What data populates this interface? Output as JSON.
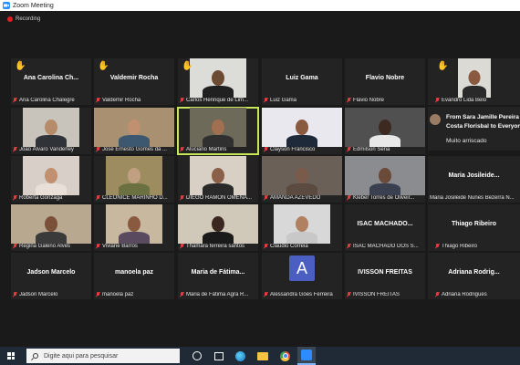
{
  "window": {
    "title": "Zoom Meeting"
  },
  "recording": {
    "label": "Recording"
  },
  "tiles": [
    {
      "big": "Ana Carolina Ch...",
      "name": "Ana Carolina Chalegre",
      "hand": true
    },
    {
      "big": "Valdemir Rocha",
      "name": "Valdemir Rocha",
      "hand": true
    },
    {
      "big": "",
      "name": "Carlos Henrique de Lim...",
      "hand": true
    },
    {
      "big": "Luiz Gama",
      "name": "Luiz Gama",
      "hand": false
    },
    {
      "big": "Flavio Nobre",
      "name": "Flavio Nobre",
      "hand": false
    },
    {
      "big": "",
      "name": "João Álvaro Vanderley",
      "hand": false
    },
    {
      "big": "",
      "name": "Jose Ernesto Gomes da ...",
      "hand": false
    },
    {
      "big": "",
      "name": "Aluciano Martins",
      "hand": false
    },
    {
      "big": "",
      "name": "Clayson Francisco",
      "hand": false
    },
    {
      "big": "",
      "name": "Edmilson Sena",
      "hand": false
    },
    {
      "big": "",
      "name": "Roberta Gonzaga",
      "hand": false
    },
    {
      "big": "",
      "name": "CLEONICE MARINHO D...",
      "hand": false
    },
    {
      "big": "",
      "name": "DIEGO RAMON OMENA...",
      "hand": false
    },
    {
      "big": "",
      "name": "AMANDA AZEVEDO",
      "hand": false
    },
    {
      "big": "",
      "name": "Kleber Torres de Oliveir...",
      "hand": false
    },
    {
      "big": "",
      "name": "Regina Galeno Alves",
      "hand": false
    },
    {
      "big": "",
      "name": "Viviane Barros",
      "hand": false
    },
    {
      "big": "",
      "name": "Thamara ferreira santos",
      "hand": false
    },
    {
      "big": "",
      "name": "Claudio Correia",
      "hand": false
    },
    {
      "big": "ISAC  MACHADO...",
      "name": "ISAC MACHADO DOS S...",
      "hand": false
    },
    {
      "big": "Jadson Marcelo",
      "name": "Jadson Marcelo",
      "hand": false
    },
    {
      "big": "manoela paz",
      "name": "manoela paz",
      "hand": false
    },
    {
      "big": "Maria  de  Fátima...",
      "name": "Maria de Fátima Agra R...",
      "hand": false
    },
    {
      "big": "",
      "name": "Alessandra Góes Ferreira",
      "hand": false,
      "avatar": "A"
    },
    {
      "big": "IVISSON FREITAS",
      "name": "IVISSON FREITAS",
      "hand": false
    }
  ],
  "right": [
    {
      "big": "",
      "name": "Evandro Lida Belo",
      "hand": true
    },
    {
      "big": "Maria  Josileide...",
      "name": "Maria Josileide Nunes Bezerra N...",
      "hand": false
    },
    {
      "big": "Thiago Ribeiro",
      "name": "Thiago Ribeiro",
      "hand": false
    },
    {
      "big": "Adriana  Rodrig...",
      "name": "Adriana Rodrigues",
      "hand": false
    }
  ],
  "chat": {
    "from_line1": "From Sara Jamille Pereira",
    "from_line2": "Costa Florisbal to Everyone",
    "message": "Muito arriscado"
  },
  "taskbar": {
    "search_placeholder": "Digite aqui para pesquisar"
  },
  "colors": {
    "tile": "#232323",
    "active": "#c8e65a",
    "mic_muted": "#e34040",
    "zoom": "#2d8cff"
  }
}
